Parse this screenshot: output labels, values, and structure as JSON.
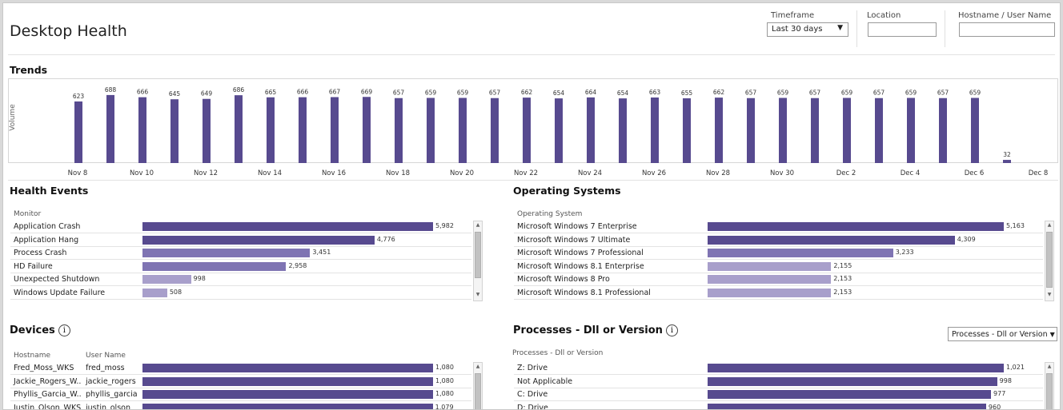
{
  "page": {
    "title": "Desktop Health"
  },
  "filters": {
    "timeframe": {
      "label": "Timeframe",
      "value": "Last 30 days",
      "arrow": "▼"
    },
    "location": {
      "label": "Location",
      "value": ""
    },
    "hostname": {
      "label": "Hostname / User Name",
      "value": ""
    }
  },
  "trends": {
    "title": "Trends",
    "ylabel": "Volume",
    "chart_data": {
      "type": "bar",
      "xlabel": "",
      "ylabel": "Volume",
      "x_ticks": [
        "Nov 8",
        "Nov 10",
        "Nov 12",
        "Nov 14",
        "Nov 16",
        "Nov 18",
        "Nov 20",
        "Nov 22",
        "Nov 24",
        "Nov 26",
        "Nov 28",
        "Nov 30",
        "Dec 2",
        "Dec 4",
        "Dec 6",
        "Dec 8"
      ],
      "categories": [
        "Nov 8",
        "Nov 9",
        "Nov 10",
        "Nov 11",
        "Nov 12",
        "Nov 13",
        "Nov 14",
        "Nov 15",
        "Nov 16",
        "Nov 17",
        "Nov 18",
        "Nov 19",
        "Nov 20",
        "Nov 21",
        "Nov 22",
        "Nov 23",
        "Nov 24",
        "Nov 25",
        "Nov 26",
        "Nov 27",
        "Nov 28",
        "Nov 29",
        "Nov 30",
        "Dec 1",
        "Dec 2",
        "Dec 3",
        "Dec 4",
        "Dec 5",
        "Dec 6",
        "Dec 7"
      ],
      "values": [
        623,
        688,
        666,
        645,
        649,
        686,
        665,
        666,
        667,
        669,
        657,
        659,
        659,
        657,
        662,
        654,
        664,
        654,
        663,
        655,
        662,
        657,
        659,
        657,
        659,
        657,
        659,
        657,
        659,
        32
      ],
      "ylim": [
        0,
        760
      ],
      "color": "#574a8f",
      "grid": false
    }
  },
  "health_events": {
    "title": "Health Events",
    "column": "Monitor",
    "rows": [
      {
        "label": "Application Crash",
        "value": 5982,
        "display": "5,982"
      },
      {
        "label": "Application Hang",
        "value": 4776,
        "display": "4,776"
      },
      {
        "label": "Process Crash",
        "value": 3451,
        "display": "3,451"
      },
      {
        "label": "HD Failure",
        "value": 2958,
        "display": "2,958"
      },
      {
        "label": "Unexpected Shutdown",
        "value": 998,
        "display": "998"
      },
      {
        "label": "Windows Update Failure",
        "value": 508,
        "display": "508"
      }
    ]
  },
  "operating_systems": {
    "title": "Operating Systems",
    "column": "Operating System",
    "rows": [
      {
        "label": "Microsoft Windows 7 Enterprise",
        "value": 5163,
        "display": "5,163"
      },
      {
        "label": "Microsoft Windows 7 Ultimate",
        "value": 4309,
        "display": "4,309"
      },
      {
        "label": "Microsoft Windows 7 Professional",
        "value": 3233,
        "display": "3,233"
      },
      {
        "label": "Microsoft Windows 8.1 Enterprise",
        "value": 2155,
        "display": "2,155"
      },
      {
        "label": "Microsoft Windows 8 Pro",
        "value": 2153,
        "display": "2,153"
      },
      {
        "label": "Microsoft Windows 8.1 Professional",
        "value": 2153,
        "display": "2,153"
      }
    ]
  },
  "devices": {
    "title": "Devices",
    "columns": [
      "Hostname",
      "User Name"
    ],
    "rows": [
      {
        "host": "Fred_Moss_WKS",
        "user": "fred_moss",
        "value": 1080,
        "display": "1,080"
      },
      {
        "host": "Jackie_Rogers_W..",
        "user": "jackie_rogers",
        "value": 1080,
        "display": "1,080"
      },
      {
        "host": "Phyllis_Garcia_W..",
        "user": "phyllis_garcia",
        "value": 1080,
        "display": "1,080"
      },
      {
        "host": "Justin_Olson_WKS",
        "user": "justin_olson",
        "value": 1079,
        "display": "1,079"
      }
    ]
  },
  "processes": {
    "title": "Processes - Dll or Version",
    "column": "Processes - Dll or Version",
    "dropdown": "Processes - Dll or Version",
    "dropdown_arrow": "▼",
    "rows": [
      {
        "label": "Z: Drive",
        "value": 1021,
        "display": "1,021"
      },
      {
        "label": "Not Applicable",
        "value": 998,
        "display": "998"
      },
      {
        "label": "C: Drive",
        "value": 977,
        "display": "977"
      },
      {
        "label": "D: Drive",
        "value": 960,
        "display": "960"
      }
    ]
  },
  "icons": {
    "info": "info-icon",
    "scroll_up": "▲",
    "scroll_down": "▼"
  },
  "colors": {
    "bar": "#574a8f",
    "bar_light": "#a89fcb",
    "bar_mid": "#7f74b3"
  }
}
